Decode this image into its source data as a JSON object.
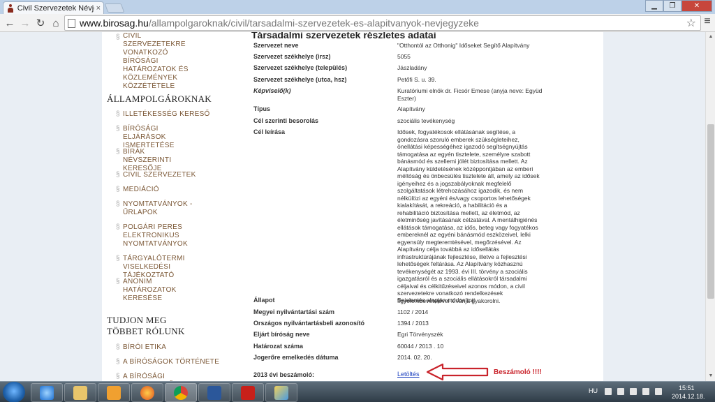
{
  "browser": {
    "tab_title": "Civil Szervezetek Névjegyz",
    "tab_close": "×",
    "url_host": "www.birosag.hu",
    "url_path": "/allampolgaroknak/civil/tarsadalmi-szervezetek-es-alapitvanyok-nevjegyzeke",
    "back_icon": "←",
    "forward_icon": "→",
    "reload_icon": "↻",
    "home_icon": "⌂",
    "star_icon": "☆",
    "menu_icon": "≡",
    "minimize_icon": "▁",
    "maximize_icon": "❐",
    "close_icon": "✕"
  },
  "sidebar": {
    "top_link": "CIVIL SZERVEZETEKRE VONATKOZÓ BÍRÓSÁGI HATÁROZATOK ÉS KÖZLEMÉNYEK KÖZZÉTÉTELE",
    "heading_citizens": "ÁLLAMPOLGÁROKNAK",
    "citizen_links": [
      "ILLETÉKESSÉG KERESŐ",
      "BÍRÓSÁGI ELJÁRÁSOK ISMERTETÉSE",
      "BÍRÁK NÉVSZERINTI KERESŐJE",
      "CIVIL SZERVEZETEK",
      "MEDIÁCIÓ",
      "NYOMTATVÁNYOK - ŰRLAPOK",
      "POLGÁRI PERES ELEKTRONIKUS NYOMTATVÁNYOK",
      "TÁRGYALÓTERMI VISELKEDÉSI TÁJÉKOZTATÓ",
      "ANONIM HATÁROZATOK KERESÉSE"
    ],
    "heading_about": "TUDJON MEG TÖBBET RÓLUNK",
    "about_links": [
      "BÍRÓI ETIKA",
      "A BÍRÓSÁGOK TÖRTÉNETE",
      "A BÍRÓSÁGI RENDSZERRŐL"
    ],
    "bullet": "§"
  },
  "detail": {
    "heading": "Társadalmi szervezetek részletes adatai",
    "rows": [
      {
        "label": "Szervezet neve",
        "value": "\"Otthontól az Otthonig\" Időseket Segítő Alapítvány"
      },
      {
        "label": "Szervezet székhelye (irsz)",
        "value": "5055"
      },
      {
        "label": "Szervezet székhelye (település)",
        "value": "Jászladány"
      },
      {
        "label": "Szervezet székhelye (utca, hsz)",
        "value": "Petőfi S. u. 39."
      },
      {
        "label": "Képviselő(k)",
        "value": "Kuratóriumi elnök dr. Ficsór Emese (anyja neve: Együd Eszter)"
      },
      {
        "label": "Típus",
        "value": "Alapítvány"
      },
      {
        "label": "Cél szerinti besorolás",
        "value": "szociális tevékenység"
      },
      {
        "label": "Cél leírása",
        "value": "Idősek, fogyatékosok ellátásának segítése, a gondozásra szoruló emberek szükségleteihez, önellátási képességéhez igazodó segítségnyújtás támogatása az egyén tisztelete, személyre szabott bánásmód és szellemi jólét biztosítása mellett. Az Alapítvány küldetésének középpontjában az emberi méltóság és önbecsülés tisztelete áll, amely az idősek igényeihez és a jogszabályoknak megfelelő szolgáltatások létrehozásához igazodik, és nem nélkülözi az egyéni és/vagy csoportos lehetőségek kialakítását, a rekreáció, a habilitáció és a rehabilitáció biztosítása mellett, az életmód, az életminőség javításának célzatával. A mentálhigiénés ellátások támogatása, az idős, beteg vagy fogyatékos embereknél az egyéni bánásmód eszközeivel, lelki egyensúly megteremtésével, megőrzésével. Az Alapítvány célja továbbá az idősellátás infrastruktúrájának fejlesztése, illetve a fejlesztési lehetőségek feltárása. Az Alapítvány közhasznú tevékenységét az 1993. évi III. törvény a szociális igazgatásról és a szociális ellátásokról társadalmi céljaival és célkitűzéseivel azonos módon, a civil szervezetekre vonatkozó rendelkezések figyelembevételével kívánja gyakorolni."
      },
      {
        "label": "Állapot",
        "value": "Bejelentés alapján módosított"
      },
      {
        "label": "Megyei nyilvántartási szám",
        "value": "1102 / 2014"
      },
      {
        "label": "Országos nyilvántartásbeli azonosító",
        "value": "1394 / 2013"
      },
      {
        "label": "Eljárt bíróság neve",
        "value": "Egri Törvényszék"
      },
      {
        "label": "Határozat száma",
        "value": "60044 / 2013 . 10"
      },
      {
        "label": "Jogerőre emelkedés dátuma",
        "value": "2014. 02. 20."
      },
      {
        "label": "2013 évi beszámoló:",
        "value": "Letöltés"
      }
    ],
    "annotation": "Beszámoló !!!!",
    "annotation_color": "#c9232b"
  },
  "taskbar": {
    "language": "HU",
    "time": "15:51",
    "date": "2014.12.18.",
    "apps": [
      "internet-explorer",
      "file-explorer",
      "media-player",
      "firefox",
      "chrome",
      "word",
      "acrobat",
      "paint"
    ]
  }
}
